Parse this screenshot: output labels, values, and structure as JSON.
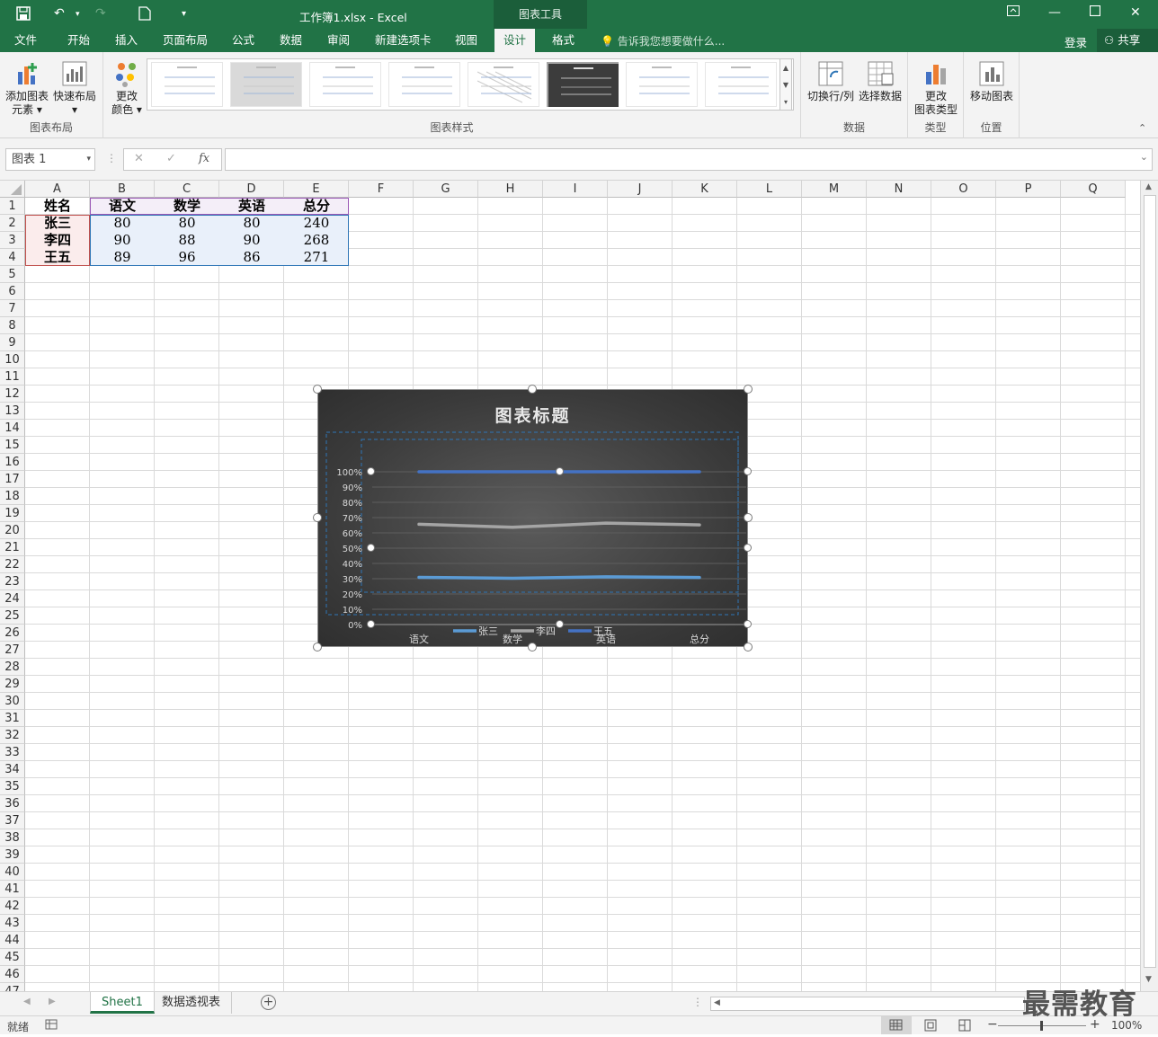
{
  "titlebar": {
    "filename": "工作簿1.xlsx - Excel",
    "context_tool": "图表工具"
  },
  "tabs": [
    "文件",
    "开始",
    "插入",
    "页面布局",
    "公式",
    "数据",
    "审阅",
    "新建选项卡",
    "视图",
    "设计",
    "格式"
  ],
  "active_tab": "设计",
  "tell_me": "告诉我您想要做什么...",
  "login": "登录",
  "share": "共享",
  "ribbon": {
    "add_element": [
      "添加图表",
      "元素"
    ],
    "quick_layout": "快速布局",
    "change_color": [
      "更改",
      "颜色"
    ],
    "group_layout": "图表布局",
    "group_styles": "图表样式",
    "switch_rowcol": "切换行/列",
    "select_data": "选择数据",
    "group_data": "数据",
    "change_type": [
      "更改",
      "图表类型"
    ],
    "group_type": "类型",
    "move_chart": "移动图表",
    "group_location": "位置"
  },
  "formula_bar": {
    "name_box": "图表 1",
    "fx": "fx",
    "value": ""
  },
  "columns": [
    "A",
    "B",
    "C",
    "D",
    "E",
    "F",
    "G",
    "H",
    "I",
    "J",
    "K",
    "L",
    "M",
    "N",
    "O",
    "P",
    "Q"
  ],
  "rows": [
    "1",
    "2",
    "3",
    "4",
    "5",
    "6",
    "7",
    "8",
    "9",
    "10",
    "11",
    "12",
    "13",
    "14",
    "15",
    "16",
    "17",
    "18",
    "19",
    "20",
    "21",
    "22",
    "23",
    "24",
    "25",
    "26",
    "27",
    "28",
    "29",
    "30",
    "31",
    "32",
    "33",
    "34",
    "35",
    "36",
    "37",
    "38",
    "39",
    "40",
    "41",
    "42",
    "43",
    "44",
    "45",
    "46",
    "47"
  ],
  "table": {
    "header": [
      "姓名",
      "语文",
      "数学",
      "英语",
      "总分"
    ],
    "rows": [
      [
        "张三",
        "80",
        "80",
        "80",
        "240"
      ],
      [
        "李四",
        "90",
        "88",
        "90",
        "268"
      ],
      [
        "王五",
        "89",
        "96",
        "86",
        "271"
      ]
    ]
  },
  "chart": {
    "title": "图表标题",
    "chart_data": {
      "type": "line",
      "stacked_percent": true,
      "categories": [
        "语文",
        "数学",
        "英语",
        "总分"
      ],
      "series": [
        {
          "name": "张三",
          "values": [
            80,
            80,
            80,
            240
          ],
          "color": "#5b9bd5"
        },
        {
          "name": "李四",
          "values": [
            90,
            88,
            90,
            268
          ],
          "color": "#a5a5a5"
        },
        {
          "name": "王五",
          "values": [
            89,
            96,
            86,
            271
          ],
          "color": "#4472c4"
        }
      ],
      "ylim": [
        0,
        1
      ],
      "yticks": [
        "0%",
        "10%",
        "20%",
        "30%",
        "40%",
        "50%",
        "60%",
        "70%",
        "80%",
        "90%",
        "100%"
      ],
      "legend": "bottom",
      "grid": true
    }
  },
  "sheets": [
    "Sheet1",
    "数据透视表"
  ],
  "active_sheet": "Sheet1",
  "status": {
    "ready": "就绪",
    "zoom": "100%"
  },
  "watermark": "最需教育"
}
